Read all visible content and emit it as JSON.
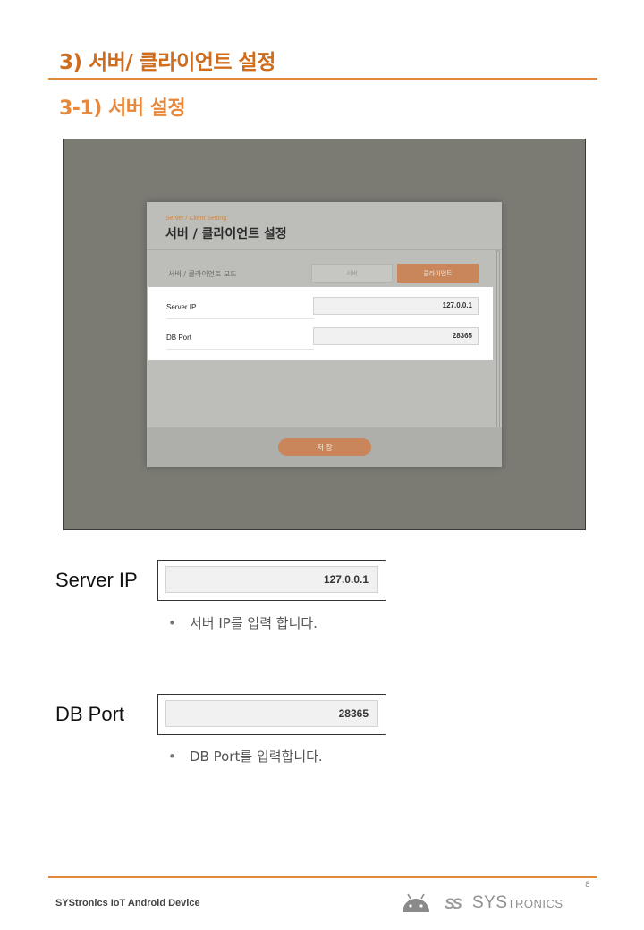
{
  "heading": "3) 서버/ 클라이언트 설정",
  "subheading": "3-1)  서버 설정",
  "screenshot": {
    "dialog_subtitle": "Server / Client Setting",
    "dialog_title": "서버 / 클라이언트 설정",
    "mode_label": "서버 / 클라이언트 모드",
    "mode_options": [
      "서버",
      "클라이언트"
    ],
    "mode_selected": "클라이언트",
    "server_ip_label": "Server IP",
    "server_ip_value": "127.0.0.1",
    "db_port_label": "DB Port",
    "db_port_value": "28365",
    "save_label": "저 장"
  },
  "server_ip_section": {
    "label": "Server IP",
    "value": "127.0.0.1",
    "bullet_marker": "•",
    "bullet": "서버 IP를 입력 합니다."
  },
  "db_port_section": {
    "label": "DB Port",
    "value": "28365",
    "bullet_marker": "•",
    "bullet": "DB Port를 입력합니다."
  },
  "footer": {
    "page_number": "8",
    "doc_title": "SYStronics IoT Android Device",
    "brand_mark": "SS",
    "brand_text_large": "SYS",
    "brand_text_small": "TRONICS"
  },
  "colors": {
    "accent": "#e0893c",
    "heading": "#cf6d1c",
    "button": "#c8865a"
  }
}
